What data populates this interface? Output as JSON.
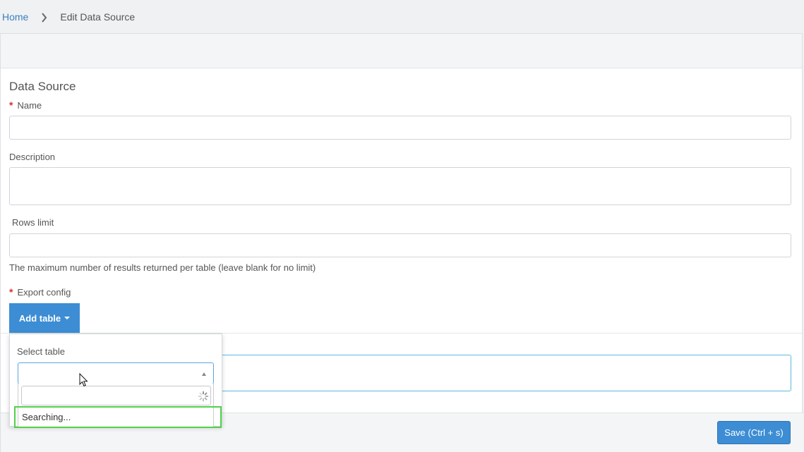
{
  "breadcrumb": {
    "home": "Home",
    "current": "Edit Data Source"
  },
  "form": {
    "section_title": "Data Source",
    "name_label": "Name",
    "description_label": "Description",
    "rows_limit_label": "Rows limit",
    "rows_limit_hint": "The maximum number of results returned per table (leave blank for no limit)",
    "export_config_label": "Export config",
    "required_marker": "*"
  },
  "add_table": {
    "label": "Add table",
    "dropdown": {
      "select_label": "Select table",
      "status": "Searching..."
    }
  },
  "footer": {
    "save_label": "Save (Ctrl + s)"
  },
  "colors": {
    "primary": "#3c8dd4",
    "link": "#3c7fbf",
    "required": "#d9302f",
    "highlight": "#4fd14b"
  }
}
